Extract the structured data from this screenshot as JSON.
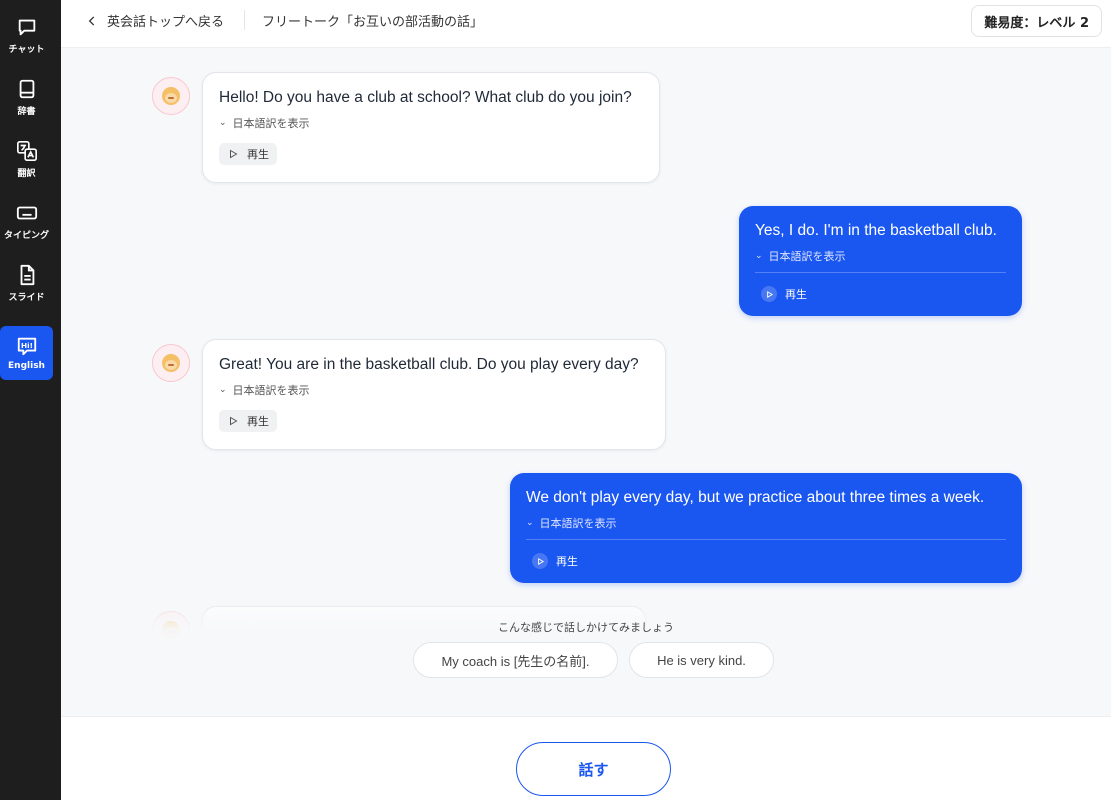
{
  "sidebar": {
    "items": [
      {
        "label": "チャット",
        "icon": "chat-icon"
      },
      {
        "label": "辞書",
        "icon": "book-icon"
      },
      {
        "label": "翻訳",
        "icon": "translate-icon"
      },
      {
        "label": "タイピング",
        "icon": "keyboard-icon"
      },
      {
        "label": "スライド",
        "icon": "document-icon"
      },
      {
        "label": "English",
        "icon": "hi-speech-icon",
        "active": true
      }
    ]
  },
  "header": {
    "back_label": "英会話トップへ戻る",
    "title": "フリートーク「お互いの部活動の話」",
    "level": "難易度：レベル 2"
  },
  "messages": [
    {
      "sender": "bot",
      "text": "Hello! Do you have a club at school? What club do you join?",
      "translate_label": "日本語訳を表示",
      "play_label": "再生"
    },
    {
      "sender": "me",
      "text": "Yes, I do. I'm in the basketball club.",
      "translate_label": "日本語訳を表示",
      "play_label": "再生"
    },
    {
      "sender": "bot",
      "text": "Great! You are in the basketball club. Do you play every day?",
      "translate_label": "日本語訳を表示",
      "play_label": "再生"
    },
    {
      "sender": "me",
      "text": "We don't play every day, but we practice about three times a week.",
      "translate_label": "日本語訳を表示",
      "play_label": "再生"
    }
  ],
  "suggestions": {
    "hint": "こんな感じで話しかけてみましょう",
    "items": [
      "My coach is [先生の名前].",
      "He is very kind."
    ]
  },
  "footer": {
    "speak_label": "話す"
  },
  "colors": {
    "accent": "#1a56f0",
    "sidebar_bg": "#1e1e1e",
    "page_bg": "#f7f8fa"
  }
}
